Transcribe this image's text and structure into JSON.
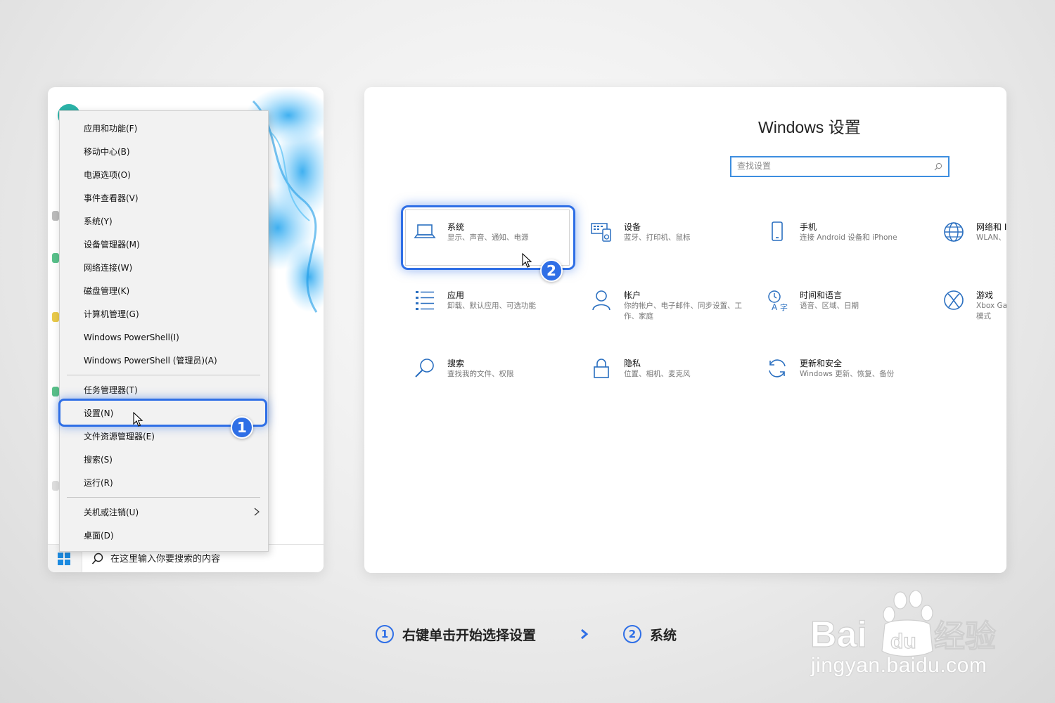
{
  "left_panel": {
    "taskbar": {
      "search_placeholder": "在这里输入你要搜索的内容"
    },
    "context_menu": {
      "items": [
        {
          "label": "应用和功能(F)"
        },
        {
          "label": "移动中心(B)"
        },
        {
          "label": "电源选项(O)"
        },
        {
          "label": "事件查看器(V)"
        },
        {
          "label": "系统(Y)"
        },
        {
          "label": "设备管理器(M)"
        },
        {
          "label": "网络连接(W)"
        },
        {
          "label": "磁盘管理(K)"
        },
        {
          "label": "计算机管理(G)"
        },
        {
          "label": "Windows PowerShell(I)"
        },
        {
          "label": "Windows PowerShell (管理员)(A)"
        },
        {
          "label": "任务管理器(T)"
        },
        {
          "label": "设置(N)",
          "highlighted": true
        },
        {
          "label": "文件资源管理器(E)"
        },
        {
          "label": "搜索(S)"
        },
        {
          "label": "运行(R)"
        },
        {
          "label": "关机或注销(U)",
          "has_submenu": true
        },
        {
          "label": "桌面(D)"
        }
      ]
    },
    "step_badge": "1"
  },
  "settings": {
    "title": "Windows 设置",
    "search_placeholder": "查找设置",
    "step_badge": "2",
    "tiles": [
      {
        "name": "系统",
        "desc": "显示、声音、通知、电源",
        "icon": "laptop-icon"
      },
      {
        "name": "设备",
        "desc": "蓝牙、打印机、鼠标",
        "icon": "devices-icon"
      },
      {
        "name": "手机",
        "desc": "连接 Android 设备和 iPhone",
        "icon": "phone-icon"
      },
      {
        "name": "网络和 I",
        "desc": "WLAN、",
        "icon": "globe-icon"
      },
      {
        "name": "应用",
        "desc": "卸载、默认应用、可选功能",
        "icon": "apps-list-icon"
      },
      {
        "name": "帐户",
        "desc": "你的帐户、电子邮件、同步设置、工作、家庭",
        "icon": "person-icon"
      },
      {
        "name": "时间和语言",
        "desc": "语音、区域、日期",
        "icon": "time-language-icon"
      },
      {
        "name": "游戏",
        "desc": "Xbox Ga 模式",
        "icon": "xbox-icon"
      },
      {
        "name": "搜索",
        "desc": "查找我的文件、权限",
        "icon": "search-icon"
      },
      {
        "name": "隐私",
        "desc": "位置、相机、麦克风",
        "icon": "lock-icon"
      },
      {
        "name": "更新和安全",
        "desc": "Windows 更新、恢复、备份",
        "icon": "refresh-icon"
      }
    ]
  },
  "caption": {
    "step1_num": "1",
    "step1_text": "右键单击开始选择设置",
    "step2_num": "2",
    "step2_text": "系统"
  },
  "watermark": {
    "brand": "Bai du 经验",
    "url": "jingyan.baidu.com"
  },
  "colors": {
    "accent": "#2f6fe6",
    "settings_icon": "#2a6fc0"
  }
}
